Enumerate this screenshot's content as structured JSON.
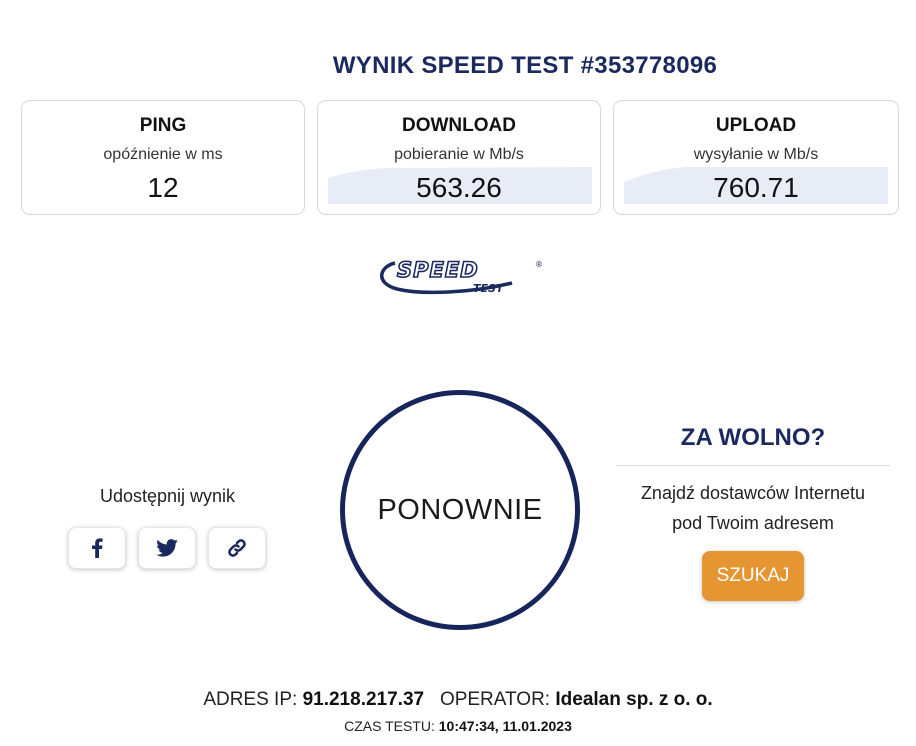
{
  "header": {
    "title": "WYNIK SPEED TEST #353778096"
  },
  "ping": {
    "label": "PING",
    "sub": "opóźnienie w ms",
    "value": "12"
  },
  "download": {
    "label": "DOWNLOAD",
    "sub": "pobieranie w Mb/s",
    "value": "563.26"
  },
  "upload": {
    "label": "UPLOAD",
    "sub": "wysyłanie w Mb/s",
    "value": "760.71"
  },
  "logo": {
    "text_main": "SPEED",
    "text_sub": "TEST",
    "mark": "®"
  },
  "retry": {
    "label": "PONOWNIE"
  },
  "share": {
    "label": "Udostępnij wynik",
    "icons": [
      "facebook-icon",
      "twitter-icon",
      "link-icon"
    ]
  },
  "slow": {
    "title": "ZA WOLNO?",
    "line1": "Znajdź dostawców Internetu",
    "line2": "pod Twoim adresem",
    "button": "SZUKAJ"
  },
  "footer": {
    "ip_label": "ADRES IP:",
    "ip_value": "91.218.217.37",
    "operator_label": "OPERATOR:",
    "operator_value": "Idealan sp. z o. o.",
    "time_label": "CZAS TESTU:",
    "time_value": "10:47:34, 11.01.2023"
  },
  "colors": {
    "navy": "#1b2a5e",
    "accent": "#e69533",
    "graph_fill": "#e8ecf6"
  }
}
